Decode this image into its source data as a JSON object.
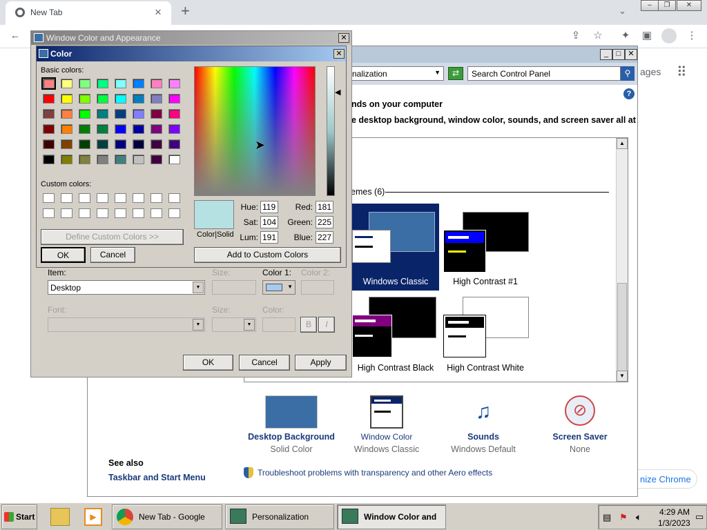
{
  "chrome": {
    "tab_title": "New Tab",
    "new_tab_plus": "+",
    "tab_close": "×",
    "images_link": "ages",
    "customize": "nize Chrome"
  },
  "cp": {
    "address": "nalization",
    "search_placeholder": "Search Control Panel",
    "heading": "nds on your computer",
    "subheading": "e desktop background, window color, sounds, and screen saver all at",
    "themes_group": "emes (6)",
    "themes": [
      {
        "label": "Windows Classic"
      },
      {
        "label": "High Contrast #1"
      },
      {
        "label": "High Contrast Black"
      },
      {
        "label": "High Contrast White"
      }
    ],
    "bottom": [
      {
        "title": "Desktop Background",
        "sub": "Solid Color"
      },
      {
        "title": "Window Color",
        "sub": "Windows Classic"
      },
      {
        "title": "Sounds",
        "sub": "Windows Default"
      },
      {
        "title": "Screen Saver",
        "sub": "None"
      }
    ],
    "see_also": "See also",
    "taskbar_link": "Taskbar and Start Menu",
    "troubleshoot": "Troubleshoot problems with transparency and other Aero effects"
  },
  "wca": {
    "title": "Window Color and Appearance",
    "item_label": "Item:",
    "item_value": "Desktop",
    "size_label": "Size:",
    "color1_label": "Color 1:",
    "color2_label": "Color 2:",
    "font_label": "Font:",
    "size2_label": "Size:",
    "color_label": "Color:",
    "bold": "B",
    "italic": "I",
    "ok": "OK",
    "cancel": "Cancel",
    "apply": "Apply"
  },
  "color_dialog": {
    "title": "Color",
    "basic_label": "Basic colors:",
    "custom_label": "Custom colors:",
    "define_custom": "Define Custom Colors >>",
    "ok": "OK",
    "cancel": "Cancel",
    "color_solid": "Color|Solid",
    "add_custom": "Add to Custom Colors",
    "hue_label": "Hue:",
    "hue": "119",
    "sat_label": "Sat:",
    "sat": "104",
    "lum_label": "Lum:",
    "lum": "191",
    "red_label": "Red:",
    "red": "181",
    "green_label": "Green:",
    "green": "225",
    "blue_label": "Blue:",
    "blue": "227",
    "basic_colors": [
      "#ff8080",
      "#ffff80",
      "#80ff80",
      "#00ff80",
      "#80ffff",
      "#0080ff",
      "#ff80c0",
      "#ff80ff",
      "#ff0000",
      "#ffff00",
      "#80ff00",
      "#00ff40",
      "#00ffff",
      "#0080c0",
      "#8080c0",
      "#ff00ff",
      "#804040",
      "#ff8040",
      "#00ff00",
      "#008080",
      "#004080",
      "#8080ff",
      "#800040",
      "#ff0080",
      "#800000",
      "#ff8000",
      "#008000",
      "#008040",
      "#0000ff",
      "#0000a0",
      "#800080",
      "#8000ff",
      "#400000",
      "#804000",
      "#004000",
      "#004040",
      "#000080",
      "#000040",
      "#400040",
      "#400080",
      "#000000",
      "#808000",
      "#808040",
      "#808080",
      "#408080",
      "#c0c0c0",
      "#400040",
      "#ffffff"
    ],
    "selected_color": "#b5e1e3"
  },
  "taskbar": {
    "start": "Start",
    "items": [
      {
        "label": "New Tab - Google Ch..."
      },
      {
        "label": "Personalization"
      },
      {
        "label": "Window Color and ..."
      }
    ],
    "time": "4:29 AM",
    "date": "1/3/2023"
  }
}
